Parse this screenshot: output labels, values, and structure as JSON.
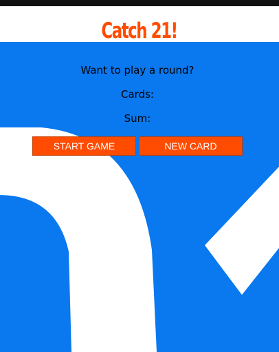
{
  "header": {
    "title": "Catch 21!"
  },
  "game": {
    "message": "Want to play a round?",
    "cards_label": "Cards:",
    "sum_label": "Sum:"
  },
  "buttons": {
    "start_label": "START GAME",
    "new_card_label": "NEW CARD"
  },
  "colors": {
    "accent": "#ff4c00",
    "background_blue": "#0a78ee",
    "header_bg": "#ffffff",
    "top_bar": "#111111"
  }
}
